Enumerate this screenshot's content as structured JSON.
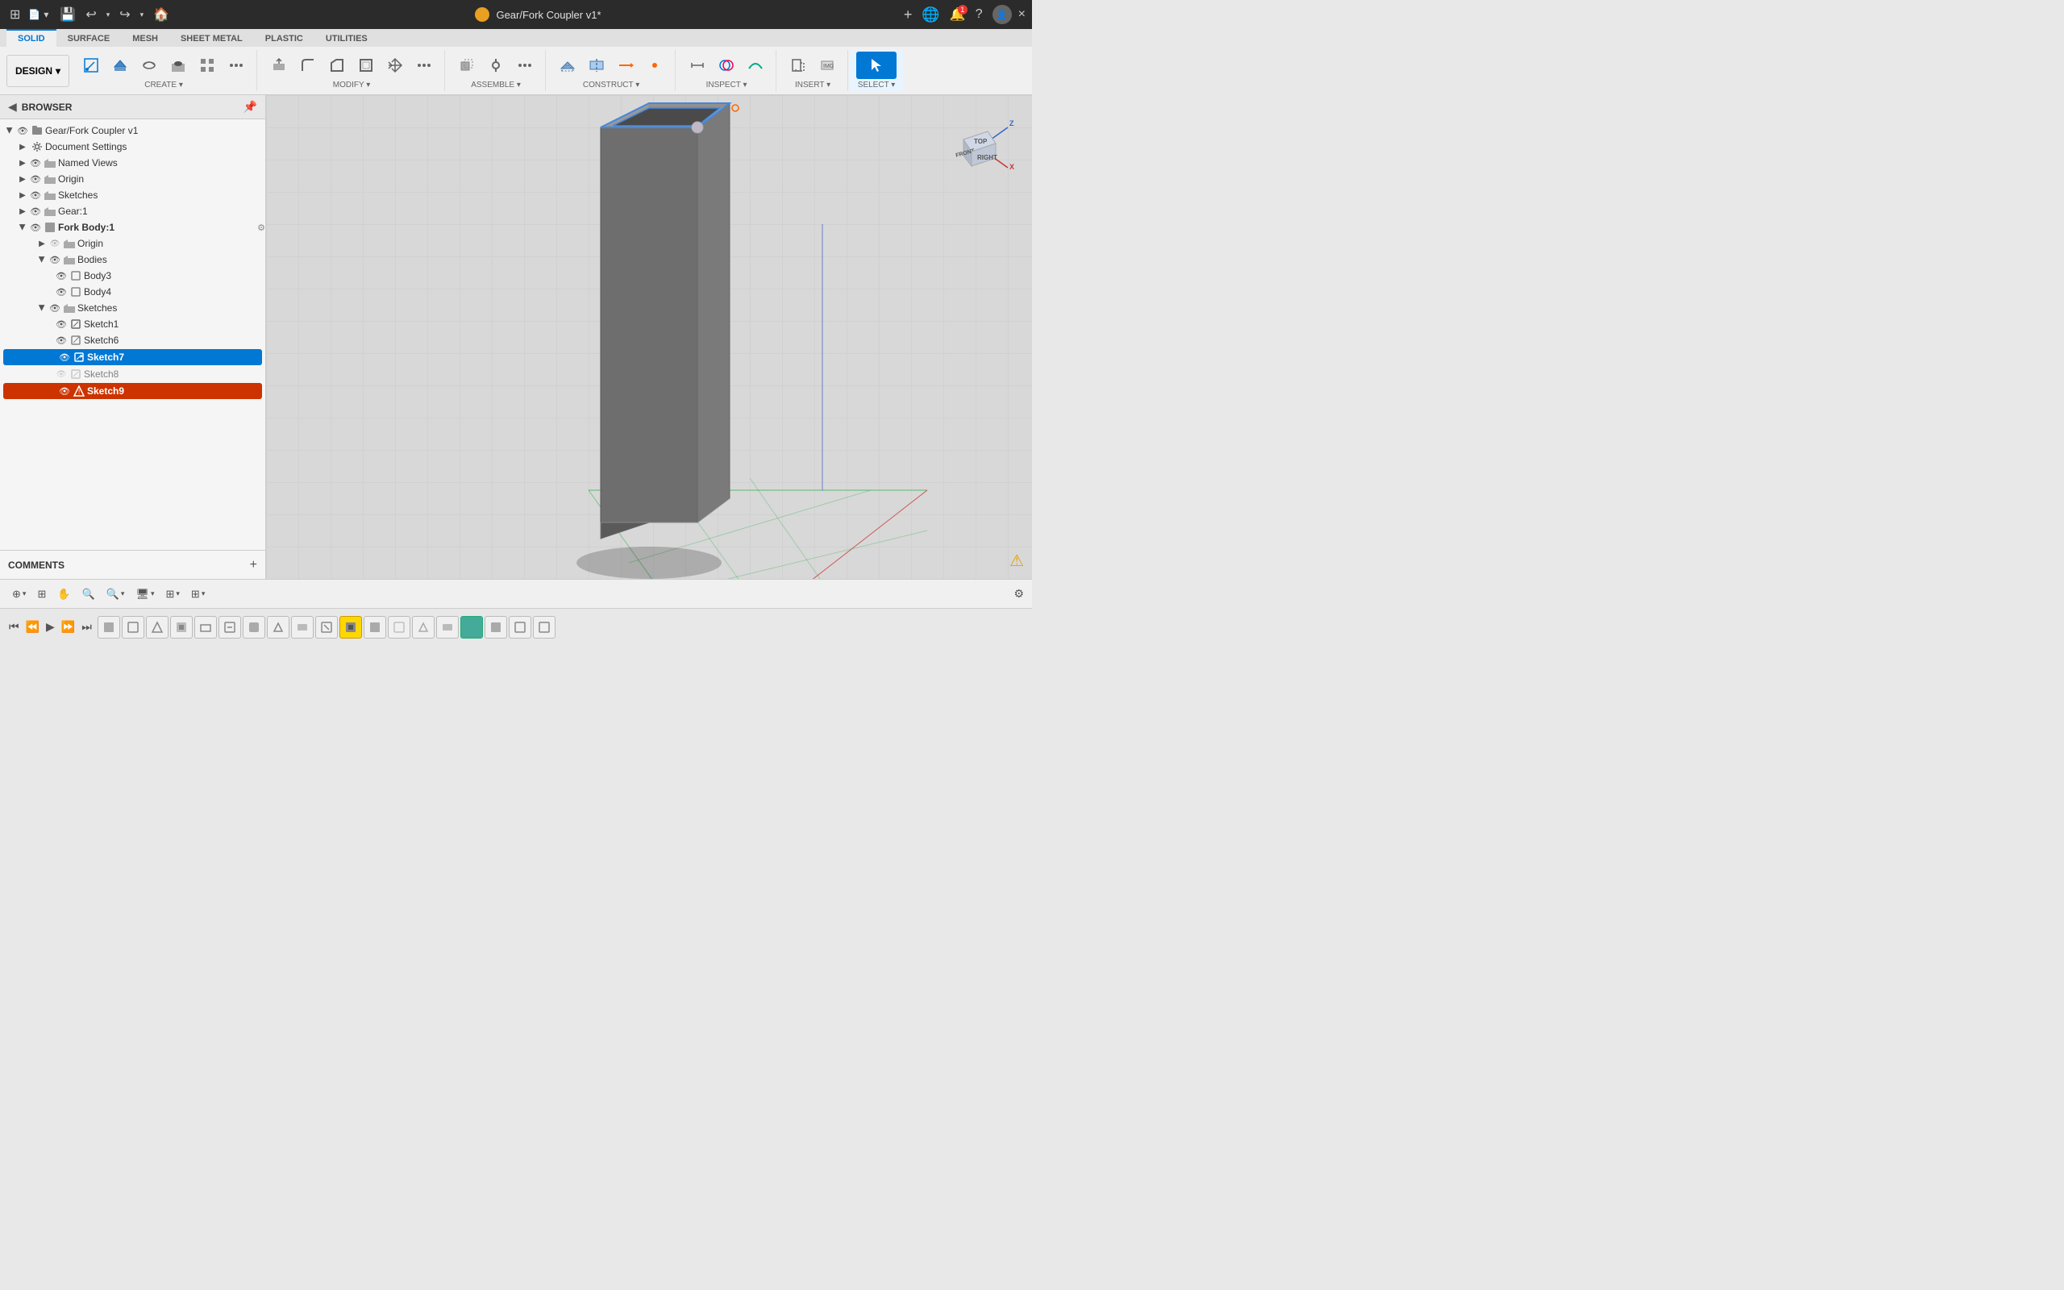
{
  "titlebar": {
    "title": "Gear/Fork Coupler v1*",
    "close_label": "×",
    "new_tab_label": "+",
    "notif_count": "1"
  },
  "ribbon": {
    "tabs": [
      {
        "id": "solid",
        "label": "SOLID",
        "active": true
      },
      {
        "id": "surface",
        "label": "SURFACE"
      },
      {
        "id": "mesh",
        "label": "MESH"
      },
      {
        "id": "sheet_metal",
        "label": "SHEET METAL"
      },
      {
        "id": "plastic",
        "label": "PLASTIC"
      },
      {
        "id": "utilities",
        "label": "UTILITIES"
      }
    ],
    "design_label": "DESIGN",
    "groups": [
      {
        "id": "create",
        "label": "CREATE ▾"
      },
      {
        "id": "modify",
        "label": "MODIFY ▾"
      },
      {
        "id": "assemble",
        "label": "ASSEMBLE ▾"
      },
      {
        "id": "construct",
        "label": "CONSTRUCT ▾"
      },
      {
        "id": "inspect",
        "label": "INSPECT ▾"
      },
      {
        "id": "insert",
        "label": "INSERT ▾"
      },
      {
        "id": "select",
        "label": "SELECT ▾"
      }
    ]
  },
  "browser": {
    "title": "BROWSER",
    "root": {
      "label": "Gear/Fork Coupler v1",
      "children": [
        {
          "label": "Document Settings",
          "icon": "gear",
          "expanded": false
        },
        {
          "label": "Named Views",
          "icon": "folder",
          "expanded": false
        },
        {
          "label": "Origin",
          "icon": "folder",
          "expanded": false
        },
        {
          "label": "Sketches",
          "icon": "folder",
          "expanded": false
        },
        {
          "label": "Gear:1",
          "icon": "folder",
          "expanded": false
        },
        {
          "label": "Fork Body:1",
          "icon": "component",
          "expanded": true,
          "children": [
            {
              "label": "Origin",
              "icon": "folder",
              "expanded": false
            },
            {
              "label": "Bodies",
              "icon": "folder",
              "expanded": true,
              "children": [
                {
                  "label": "Body3",
                  "icon": "body"
                },
                {
                  "label": "Body4",
                  "icon": "body"
                }
              ]
            },
            {
              "label": "Sketches",
              "icon": "folder",
              "expanded": true,
              "children": [
                {
                  "label": "Sketch1",
                  "icon": "sketch"
                },
                {
                  "label": "Sketch6",
                  "icon": "sketch"
                },
                {
                  "label": "Sketch7",
                  "icon": "sketch_active",
                  "highlighted": true
                },
                {
                  "label": "Sketch8",
                  "icon": "sketch_hidden"
                },
                {
                  "label": "Sketch9",
                  "icon": "sketch_warn",
                  "highlighted_warn": true
                }
              ]
            }
          ]
        }
      ]
    }
  },
  "comments": {
    "label": "COMMENTS",
    "add_label": "+"
  },
  "timeline": {
    "items": [
      {
        "type": "normal"
      },
      {
        "type": "normal"
      },
      {
        "type": "normal"
      },
      {
        "type": "normal"
      },
      {
        "type": "normal"
      },
      {
        "type": "normal"
      },
      {
        "type": "normal"
      },
      {
        "type": "normal"
      },
      {
        "type": "normal"
      },
      {
        "type": "normal"
      },
      {
        "type": "active"
      },
      {
        "type": "normal"
      },
      {
        "type": "normal"
      },
      {
        "type": "normal"
      },
      {
        "type": "normal"
      },
      {
        "type": "special"
      },
      {
        "type": "normal"
      },
      {
        "type": "normal"
      },
      {
        "type": "normal"
      },
      {
        "type": "normal"
      },
      {
        "type": "normal"
      }
    ]
  },
  "bottom_toolbar": {
    "buttons": [
      "⊕▾",
      "⊞",
      "✋",
      "🔍",
      "🔍▾",
      "🖥▾",
      "⊞▾",
      "⊞▾"
    ]
  },
  "viewcube": {
    "top_label": "TOP",
    "front_label": "FRONT",
    "right_label": "RIGHT"
  }
}
